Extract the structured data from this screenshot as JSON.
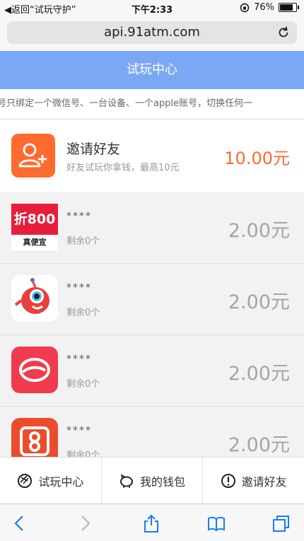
{
  "status": {
    "back": "◀返回“试玩守护”",
    "time": "下午2:33",
    "battery": "76%"
  },
  "browser": {
    "url": "api.91atm.com"
  },
  "header": {
    "title": "试玩中心"
  },
  "notice": {
    "text": "号只绑定一个微信号、一台设备、一个apple账号，切换任何一"
  },
  "invite": {
    "title": "邀请好友",
    "subtitle": "好友试玩你拿钱，最高10元",
    "amount": "10.00元"
  },
  "tasks": [
    {
      "name": "****",
      "remain": "剩余0个",
      "amount": "2.00元",
      "icon": "zhe800-icon",
      "icon_text": "折800",
      "icon_sub": "真便宜"
    },
    {
      "name": "****",
      "remain": "剩余0个",
      "amount": "2.00元",
      "icon": "red-monster-icon"
    },
    {
      "name": "****",
      "remain": "剩余0个",
      "amount": "2.00元",
      "icon": "red-e-logo-icon"
    },
    {
      "name": "****",
      "remain": "剩余0个",
      "amount": "2.00元",
      "icon": "red-s-logo-icon"
    }
  ],
  "tabbar": {
    "items": [
      {
        "label": "试玩中心",
        "icon": "aperture-icon"
      },
      {
        "label": "我的钱包",
        "icon": "wallet-pig-icon"
      },
      {
        "label": "邀请好友",
        "icon": "alert-circle-icon"
      }
    ]
  },
  "colors": {
    "header_bg": "#7aa8f5",
    "accent_orange": "#ff6a2e",
    "task_bg": "#f2f2f2"
  }
}
